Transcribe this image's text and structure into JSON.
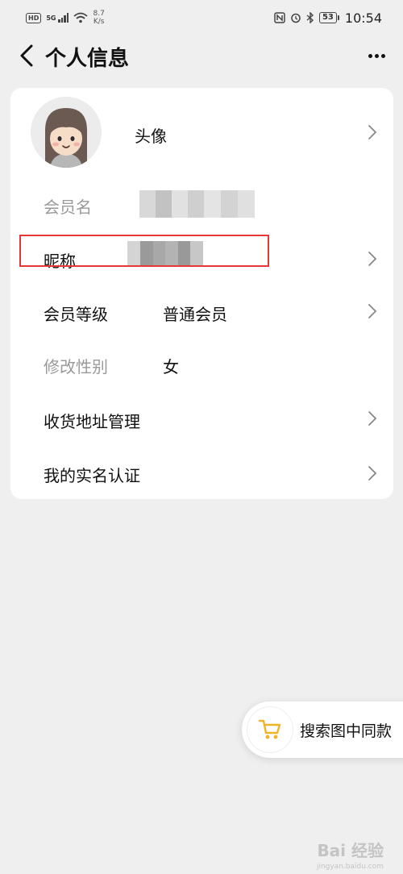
{
  "status_bar": {
    "hd": "HD",
    "network": "5G",
    "speed_value": "8.7",
    "speed_unit": "K/s",
    "battery": "53",
    "time": "10:54"
  },
  "header": {
    "title": "个人信息"
  },
  "profile": {
    "avatar_label": "头像",
    "member_name_label": "会员名",
    "nickname_label": "昵称",
    "member_level_label": "会员等级",
    "member_level_value": "普通会员",
    "gender_label": "修改性别",
    "gender_value": "女",
    "address_label": "收货地址管理",
    "realname_label": "我的实名认证"
  },
  "float_button": {
    "label": "搜索图中同款"
  },
  "watermark": {
    "text": "Bai 经验",
    "sub": "jingyan.baidu.com"
  },
  "colors": {
    "highlight": "#e53935",
    "cart": "#f0b429"
  }
}
